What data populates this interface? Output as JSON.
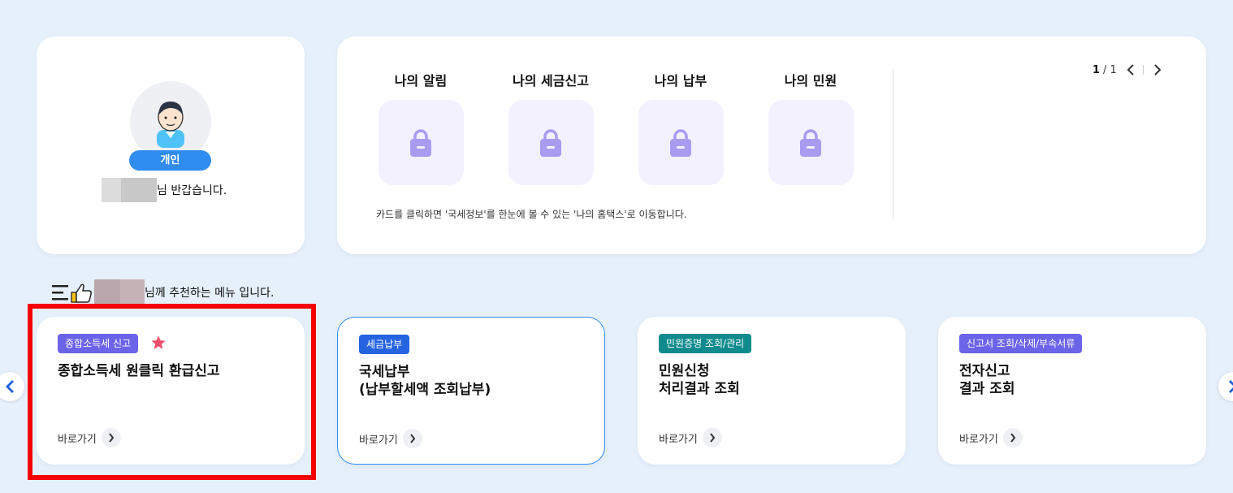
{
  "profile": {
    "user_type": "개인",
    "greeting_suffix": "님 반갑습니다."
  },
  "mytax": {
    "items": [
      {
        "title": "나의 알림",
        "icon": "lock-icon"
      },
      {
        "title": "나의 세금신고",
        "icon": "lock-icon"
      },
      {
        "title": "나의 납부",
        "icon": "lock-icon"
      },
      {
        "title": "나의 민원",
        "icon": "lock-icon"
      }
    ],
    "note": "카드를 클릭하면 '국세정보'를 한눈에 볼 수 있는 '나의 홈택스'로 이동합니다.",
    "pager": {
      "current": "1",
      "total": "/ 1"
    }
  },
  "recommend": {
    "heading_suffix": "님께 추천하는 메뉴 입니다.",
    "cards": [
      {
        "tag": "종합소득세 신고",
        "tag_color": "#6b63e8",
        "title": "종합소득세 원클릭 환급신고",
        "link": "바로가기",
        "favorite": true
      },
      {
        "tag": "세금납부",
        "tag_color": "#2563e0",
        "title": "국세납부\n(납부할세액 조회납부)",
        "link": "바로가기"
      },
      {
        "tag": "민원증명 조회/관리",
        "tag_color": "#0f8b8d",
        "title": "민원신청\n처리결과 조회",
        "link": "바로가기"
      },
      {
        "tag": "신고서 조회/삭제/부속서류",
        "tag_color": "#6b63e8",
        "title": "전자신고\n결과 조회",
        "link": "바로가기"
      }
    ]
  },
  "colors": {
    "background": "#e6f0fa",
    "accent": "#2f8cf0",
    "highlight": "#f50000",
    "lock": "#a99bf0"
  }
}
